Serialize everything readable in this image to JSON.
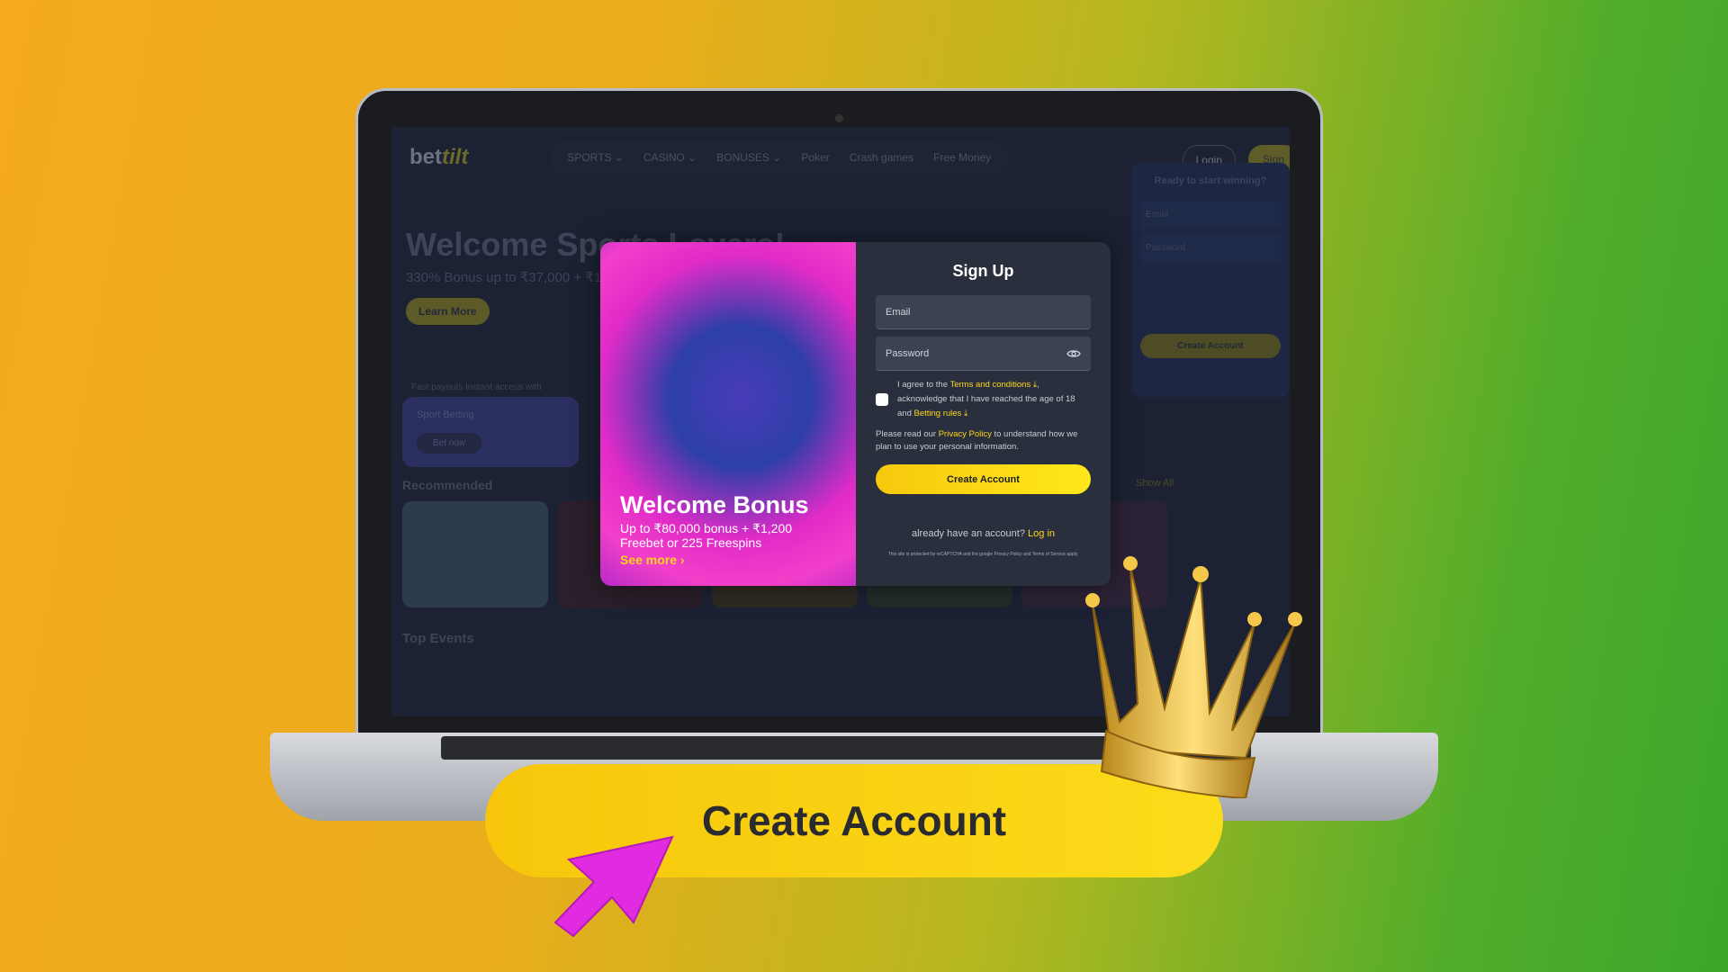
{
  "site": {
    "logo_bet": "bet",
    "logo_tilt": "tilt",
    "nav": [
      "SPORTS ⌄",
      "CASINO ⌄",
      "BONUSES ⌄",
      "Poker",
      "Crash games",
      "Free Money"
    ],
    "login": "Login",
    "sign": "Sign"
  },
  "hero": {
    "title": "Welcome Sports Lovers!",
    "subtitle": "330% Bonus up to ₹37,000 + ₹120",
    "learn_more": "Learn More",
    "features": "Fast payouts    Instant access with"
  },
  "sport_card": {
    "title": "Sport Betting",
    "cta": "Bet now"
  },
  "recommended": "Recommended",
  "top_events": "Top Events",
  "show_all": "Show All",
  "side_form": {
    "title": "Ready to start winning?",
    "email": "Email",
    "password": "Password",
    "cta": "Create Account"
  },
  "modal": {
    "promo_title": "Welcome Bonus",
    "promo_text": "Up to ₹80,000 bonus + ₹1,200 Freebet or 225 Freespins",
    "see_more": "See more ›",
    "title": "Sign Up",
    "email_placeholder": "Email",
    "password_placeholder": "Password",
    "agree_1": "I agree to the ",
    "terms": "Terms and conditions ⤓",
    "agree_2": ", acknowledge that I have reached the age of 18 and ",
    "betting_rules": "Betting rules ⤓",
    "privacy_1": "Please read our ",
    "privacy": "Privacy Policy",
    "privacy_2": " to understand how we plan to use your personal information.",
    "create": "Create Account",
    "have_account": "already have an account? ",
    "login": "Log in",
    "recaptcha": "This site is protected by reCAPTCHA and the google Privacy Policy and Terms of Service apply."
  },
  "banner": {
    "label": "Create Account"
  },
  "colors": {
    "accent": "#ffd61c",
    "cursor": "#e02be0"
  }
}
